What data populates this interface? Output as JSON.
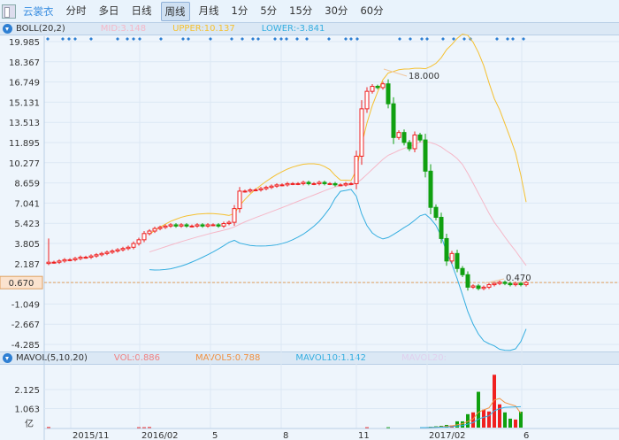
{
  "toolbar": {
    "stock": "云裳衣",
    "tabs": [
      "分时",
      "多日",
      "日线",
      "周线",
      "月线",
      "1分",
      "5分",
      "15分",
      "30分",
      "60分"
    ],
    "active": "周线"
  },
  "boll": {
    "name": "BOLL(20,2)",
    "mid": "MID:3.148",
    "upper": "UPPER:10.137",
    "lower": "LOWER:-3.841",
    "colors": {
      "mid": "#f5b8c8",
      "upper": "#f5c030",
      "lower": "#35aee0"
    }
  },
  "mavol": {
    "name": "MAVOL(5,10,20)",
    "vol": "VOL:0.886",
    "ma5": "MAVOL5:0.788",
    "ma10": "MAVOL10:1.142",
    "ma20": "MAVOL20:",
    "colors": {
      "vol": "#f08080",
      "ma5": "#f09040",
      "ma10": "#35aee0",
      "ma20": "#e0d0ee"
    }
  },
  "price_axis": [
    "19.985",
    "18.367",
    "16.749",
    "15.131",
    "13.513",
    "11.895",
    "10.277",
    "8.659",
    "7.041",
    "5.423",
    "3.805",
    "2.187",
    "0.670",
    "-1.049",
    "-2.667",
    "-4.285"
  ],
  "current_price": "0.670",
  "annotations": {
    "high": "18.000",
    "low": "0.470"
  },
  "vol_axis": [
    "2.125",
    "1.063"
  ],
  "vol_unit": "亿",
  "x_axis": [
    "2015/11",
    "2016/02",
    "5",
    "8",
    "11",
    "2017/02",
    "6"
  ],
  "chart_data": {
    "type": "candlestick",
    "price_range": [
      -4.285,
      19.985
    ],
    "close": [
      2.3,
      2.3,
      2.4,
      2.5,
      2.5,
      2.6,
      2.7,
      2.7,
      2.8,
      2.9,
      3.0,
      3.1,
      3.2,
      3.3,
      3.4,
      3.5,
      3.8,
      4.1,
      4.6,
      4.8,
      5.0,
      5.1,
      5.2,
      5.3,
      5.2,
      5.3,
      5.2,
      5.2,
      5.3,
      5.2,
      5.3,
      5.3,
      5.2,
      5.4,
      5.5,
      6.6,
      8.0,
      8.0,
      8.1,
      8.1,
      8.2,
      8.3,
      8.4,
      8.5,
      8.5,
      8.6,
      8.6,
      8.6,
      8.7,
      8.6,
      8.6,
      8.7,
      8.6,
      8.6,
      8.5,
      8.5,
      8.6,
      8.6,
      10.8,
      14.6,
      16.0,
      16.4,
      16.3,
      16.6,
      15.0,
      12.3,
      12.7,
      11.9,
      11.4,
      12.5,
      12.1,
      9.6,
      6.7,
      5.9,
      4.2,
      2.4,
      3.0,
      1.8,
      1.3,
      0.3,
      0.4,
      0.2,
      0.3,
      0.5,
      0.6,
      0.7,
      0.6,
      0.5,
      0.6,
      0.5,
      0.67
    ],
    "volume": [
      0.03,
      0,
      0,
      0,
      0,
      0,
      0,
      0,
      0,
      0,
      0,
      0,
      0,
      0,
      0,
      0,
      0,
      0.02,
      0.02,
      0.03,
      0,
      0,
      0,
      0,
      0,
      0,
      0,
      0,
      0,
      0,
      0,
      0,
      0,
      0,
      0,
      0,
      0,
      0,
      0,
      0,
      0,
      0,
      0,
      0,
      0,
      0,
      0,
      0,
      0,
      0,
      0,
      0,
      0,
      0,
      0,
      0,
      0,
      0,
      0,
      0,
      0.02,
      0,
      0,
      0,
      0.02,
      0,
      0,
      0,
      0,
      0,
      0,
      0,
      0.05,
      0.07,
      0.1,
      0.15,
      0.12,
      0.35,
      0.35,
      0.75,
      0.85,
      2.0,
      1.0,
      0.9,
      2.95,
      1.3,
      0.85,
      0.5,
      0.45,
      0.886
    ],
    "volume_range": [
      0,
      3.1
    ]
  }
}
